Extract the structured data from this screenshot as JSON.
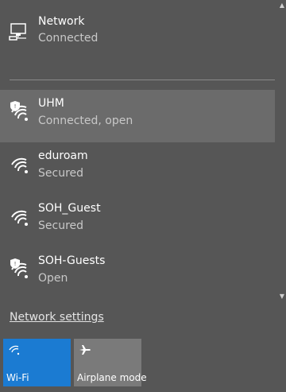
{
  "wired": {
    "name": "Network",
    "status": "Connected",
    "icon": "ethernet-computer-icon"
  },
  "networks": [
    {
      "ssid": "UHM",
      "status": "Connected, open",
      "icon": "wifi-shield-icon",
      "selected": true
    },
    {
      "ssid": "eduroam",
      "status": "Secured",
      "icon": "wifi-icon",
      "selected": false
    },
    {
      "ssid": "SOH_Guest",
      "status": "Secured",
      "icon": "wifi-icon",
      "selected": false
    },
    {
      "ssid": "SOH-Guests",
      "status": "Open",
      "icon": "wifi-shield-icon",
      "selected": false
    }
  ],
  "settings_link": "Network settings",
  "quick_actions": [
    {
      "label": "Wi-Fi",
      "icon": "wifi-icon",
      "active": true,
      "color": "#1b7bd2"
    },
    {
      "label": "Airplane mode",
      "icon": "airplane-icon",
      "active": false,
      "color": "#7a7a7a"
    }
  ],
  "colors": {
    "background": "#565656",
    "selected_row": "#6b6b6b",
    "accent": "#1b7bd2"
  }
}
